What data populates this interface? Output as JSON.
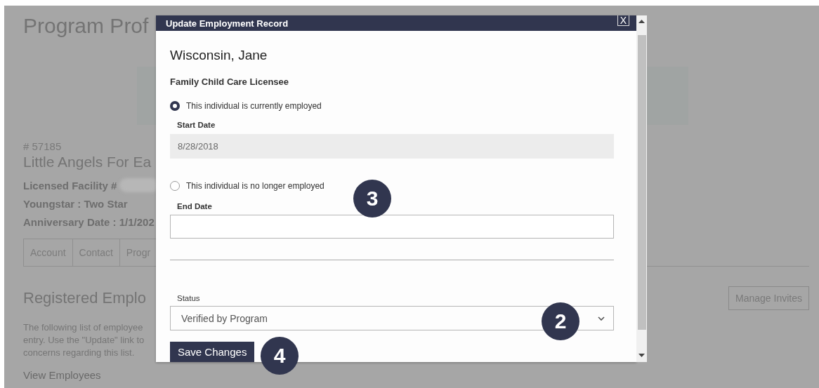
{
  "background_page": {
    "title": "Program Prof",
    "program_number": "# 57185",
    "program_name": "Little Angels For Ea",
    "details": [
      "Licensed Facility #",
      "Youngstar : Two Star",
      "Anniversary Date : 1/1/202"
    ],
    "tabs": [
      {
        "label": "Account"
      },
      {
        "label": "Contact"
      },
      {
        "label": "Progr"
      }
    ],
    "section_title": "Registered Emplo",
    "manage_button": "Manage Invites",
    "description_lines": [
      "The following list of employee",
      "entry. Use the \"Update\" link to",
      "concerns regarding this list."
    ],
    "link": "View Employees"
  },
  "modal": {
    "title": "Update Employment Record",
    "close": "X",
    "employee_name": "Wisconsin, Jane",
    "role": "Family Child Care Licensee",
    "options": [
      {
        "label": "This individual is currently employed",
        "selected": true,
        "field_label": "Start Date",
        "value": "8/28/2018",
        "disabled": true
      },
      {
        "label": "This individual is no longer employed",
        "selected": false,
        "field_label": "End Date",
        "disabled": false
      }
    ],
    "status": {
      "label": "Status",
      "value": "Verified by Program"
    },
    "save_button": "Save Changes"
  },
  "markers": [
    {
      "number": "3"
    },
    {
      "number": "2"
    },
    {
      "number": "4"
    }
  ]
}
